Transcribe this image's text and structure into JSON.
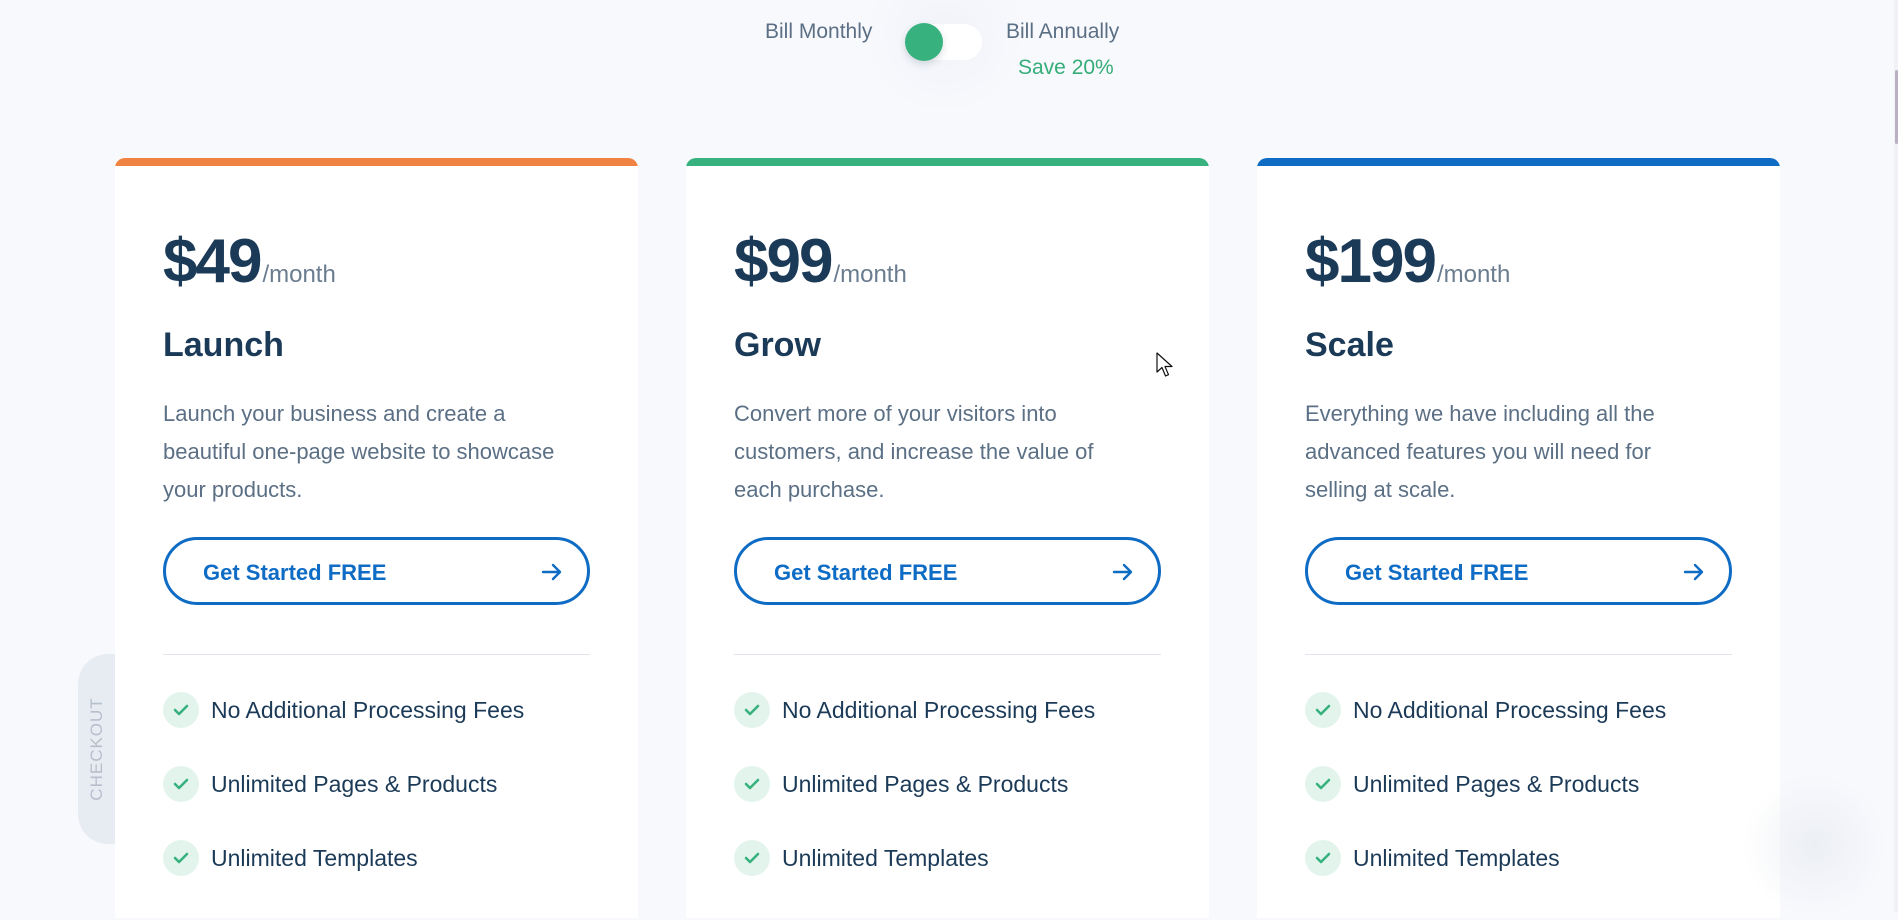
{
  "billing": {
    "monthly_label": "Bill Monthly",
    "annual_label": "Bill Annually",
    "save_label": "Save 20%",
    "annual_selected": false
  },
  "colors": {
    "launch_accent": "#f08341",
    "grow_accent": "#37b27f",
    "scale_accent": "#0f6cc5",
    "cta": "#0f6cc5",
    "check": "#37b27f"
  },
  "plans": [
    {
      "price": "$49",
      "period": "/month",
      "name": "Launch",
      "description": "Launch your business and create a beautiful one-page website to showcase your products.",
      "cta_label": "Get Started FREE",
      "features": [
        "No Additional Processing Fees",
        "Unlimited Pages & Products",
        "Unlimited Templates"
      ]
    },
    {
      "price": "$99",
      "period": "/month",
      "name": "Grow",
      "description": "Convert more of your visitors into customers, and increase the value of each purchase.",
      "cta_label": "Get Started FREE",
      "features": [
        "No Additional Processing Fees",
        "Unlimited Pages & Products",
        "Unlimited Templates"
      ]
    },
    {
      "price": "$199",
      "period": "/month",
      "name": "Scale",
      "description": "Everything we have including all the advanced features you will need for selling at scale.",
      "cta_label": "Get Started FREE",
      "features": [
        "No Additional Processing Fees",
        "Unlimited Pages & Products",
        "Unlimited Templates"
      ]
    }
  ],
  "side_tab": {
    "label": "CHECKOUT"
  },
  "icons": {
    "cta": "arrow-right-icon",
    "feature": "check-icon",
    "pointer": "mouse-cursor-icon"
  }
}
